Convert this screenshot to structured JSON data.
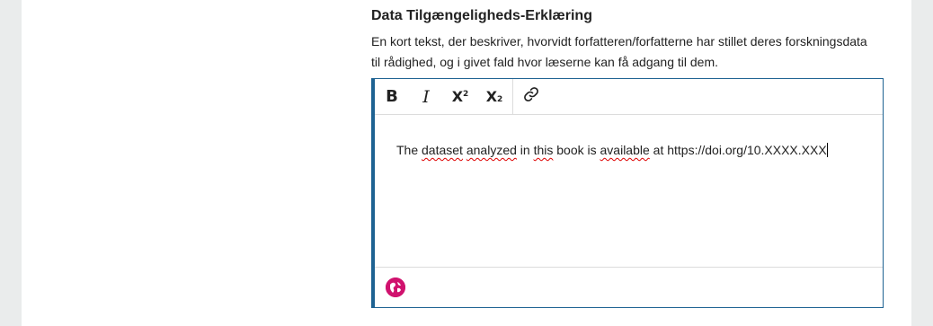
{
  "field": {
    "title": "Data Tilgængeligheds-Erklæring",
    "description": "En kort tekst, der beskriver, hvorvidt forfatteren/forfatterne har stillet deres forskningsdata til rådighed, og i givet fald hvor læserne kan få adgang til dem."
  },
  "toolbar": {
    "bold_label": "B",
    "italic_label": "I",
    "superscript_base": "X",
    "superscript_mark": "2",
    "subscript_base": "X",
    "subscript_mark": "2",
    "link_icon": "link-icon"
  },
  "editor": {
    "segments": [
      {
        "text": "The ",
        "spell": false
      },
      {
        "text": "dataset",
        "spell": true
      },
      {
        "text": " ",
        "spell": false
      },
      {
        "text": "analyzed",
        "spell": true
      },
      {
        "text": " in ",
        "spell": false
      },
      {
        "text": "this",
        "spell": true
      },
      {
        "text": " book is ",
        "spell": false
      },
      {
        "text": "available",
        "spell": true
      },
      {
        "text": " at https://doi.org/10.XXXX.XXX",
        "spell": false
      }
    ]
  },
  "footer": {
    "language_icon": "globe-icon",
    "accent_color": "#d0126e"
  },
  "colors": {
    "editor_border": "#1e6292",
    "background": "#eaecec"
  }
}
